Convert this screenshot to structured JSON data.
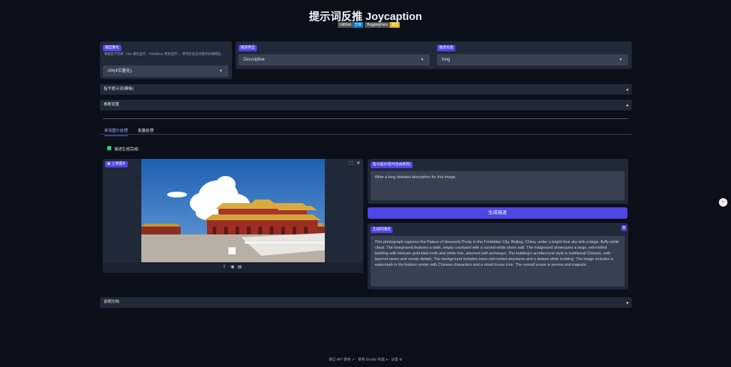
{
  "header": {
    "title": "提示词反推 Joycaption",
    "badges": [
      {
        "key": "GitHub",
        "value": "仓库",
        "color": "#007ec6"
      },
      {
        "key": "HuggingFace",
        "value": "模型",
        "color": "#dfb317"
      }
    ]
  },
  "model_panel": {
    "label": "模型量化",
    "hint": "根据显卡选择（nf4=最低显存，bf16/fp16=更高显存），更改后会自动重新加载模型。",
    "selected": "nf4(4位量化)"
  },
  "desc_type": {
    "label": "描述类型",
    "selected": "Descriptive"
  },
  "desc_length": {
    "label": "描述长度",
    "selected": "long"
  },
  "accordions": {
    "prompt_templates": "指令提示词(模板)",
    "params": "参数设置",
    "docs": "说明文档"
  },
  "tabs": [
    "单张图片处理",
    "批量处理"
  ],
  "checkbox": {
    "label": "描述生成完成!",
    "checked": true
  },
  "image_panel": {
    "label": "上传图片"
  },
  "prompt_panel": {
    "label": "指令提示词(可自由修改)",
    "value": "Write a long detailed description for this image."
  },
  "generate_button": "生成描述",
  "output_panel": {
    "label": "生成的描述",
    "text": "This photograph captures the Palace of Heavenly Purity in the Forbidden City, Beijing, China, under a bright blue sky with a large, fluffy white cloud. The foreground features a wide, empty courtyard with a curved white stone wall. The midground showcases a large, red-roofed building with intricate gold-tiled roofs and white trim, adorned with archways. The building's architectural style is traditional Chinese, with layered eaves and ornate details. The background includes more red-roofed structures and a distant white building. The image includes a watermark in the bottom center with Chinese characters and a small house icon. The overall scene is serene and majestic."
  },
  "footer": {
    "api": "通过 API 使用",
    "built": "使用 Gradio 构建",
    "settings": "设置"
  },
  "colors": {
    "background": "#0b0f19",
    "panel": "#1f2937",
    "accent": "#4f46e5"
  }
}
